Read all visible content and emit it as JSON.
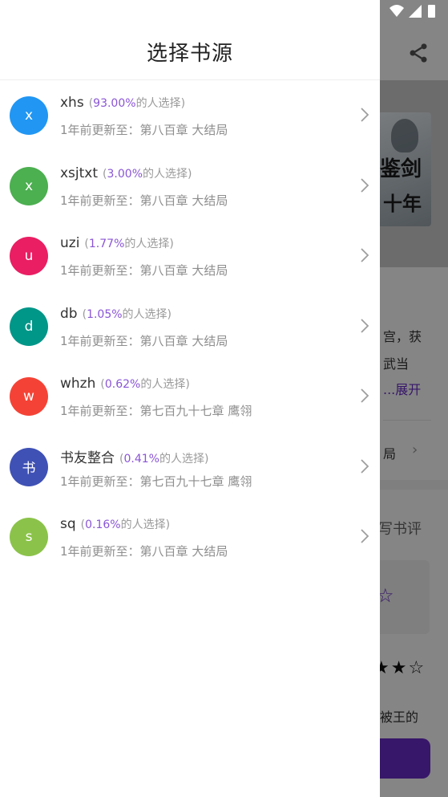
{
  "status": {
    "icons": [
      "wifi-icon",
      "signal-icon",
      "battery-icon"
    ]
  },
  "background": {
    "cover_text_1": "鉴剑",
    "cover_text_2": "十年",
    "desc_line_1": "宫，获",
    "desc_line_2": "武当",
    "more_label": "...展开",
    "latest_label": "局",
    "write_review_label": "写书评",
    "stars_display": "★★☆",
    "cut_text": "被王的",
    "accent_color": "#6a2cc9"
  },
  "drawer": {
    "title": "选择书源",
    "pct_suffix": "的人选择",
    "sources": [
      {
        "initial": "x",
        "name": "xhs",
        "percent": "93.00%",
        "updated": "1年前更新至：第八百章 大结局",
        "color": "#2196f3"
      },
      {
        "initial": "x",
        "name": "xsjtxt",
        "percent": "3.00%",
        "updated": "1年前更新至：第八百章 大结局",
        "color": "#4caf50"
      },
      {
        "initial": "u",
        "name": "uzi",
        "percent": "1.77%",
        "updated": "1年前更新至：第八百章 大结局",
        "color": "#e91e63"
      },
      {
        "initial": "d",
        "name": "db",
        "percent": "1.05%",
        "updated": "1年前更新至：第八百章 大结局",
        "color": "#009688"
      },
      {
        "initial": "w",
        "name": "whzh",
        "percent": "0.62%",
        "updated": "1年前更新至：第七百九十七章 鹰翎",
        "color": "#f44336"
      },
      {
        "initial": "书",
        "name": "书友整合",
        "percent": "0.41%",
        "updated": "1年前更新至：第七百九十七章 鹰翎",
        "color": "#3f51b5"
      },
      {
        "initial": "s",
        "name": "sq",
        "percent": "0.16%",
        "updated": "1年前更新至：第八百章 大结局",
        "color": "#8bc34a"
      }
    ]
  }
}
